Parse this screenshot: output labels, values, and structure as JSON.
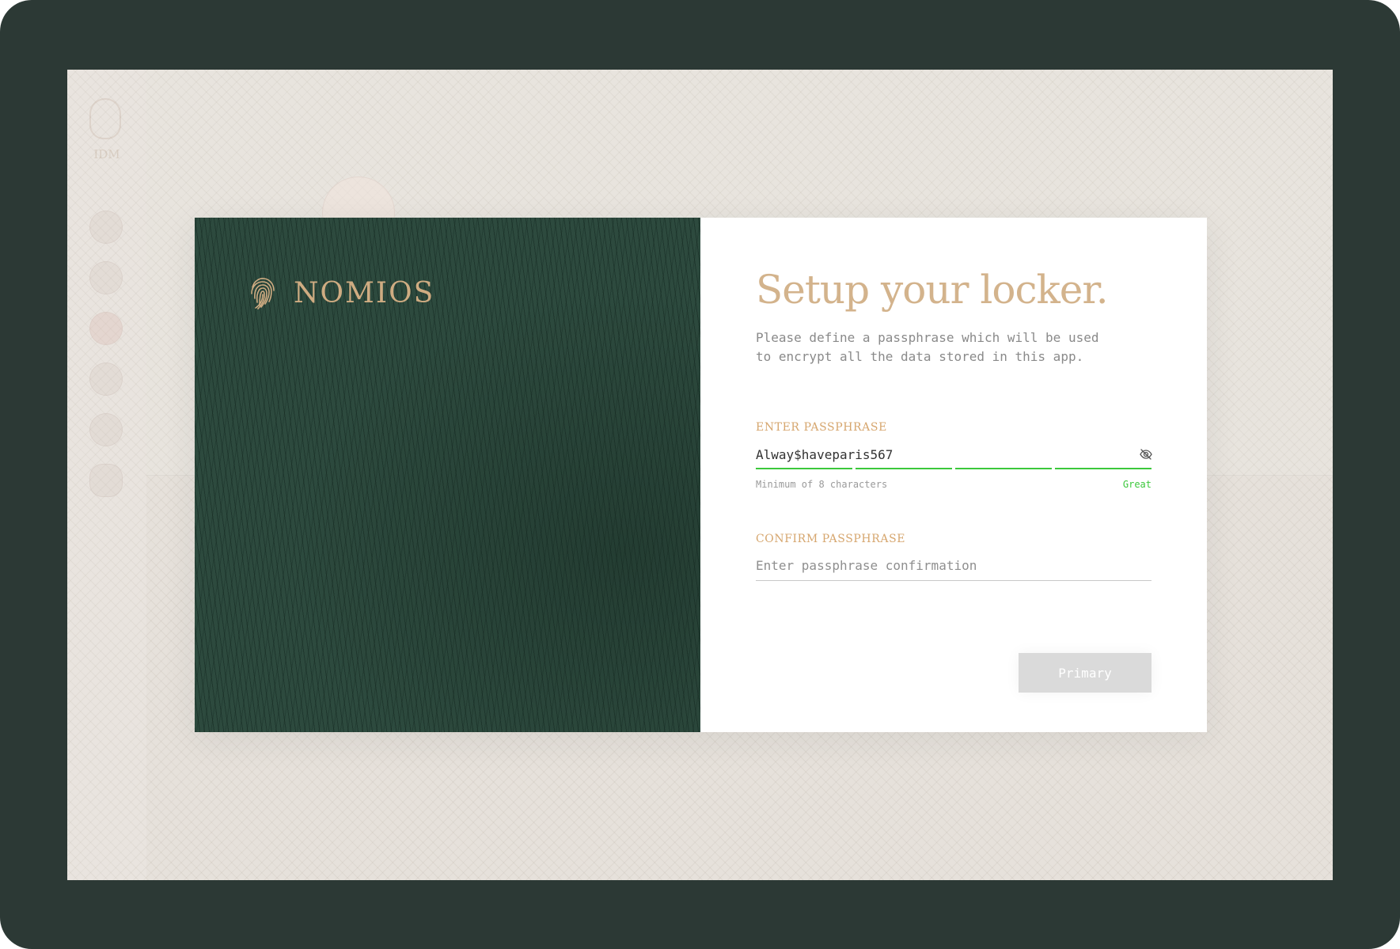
{
  "background_app": {
    "logo_text": "IDM"
  },
  "brand": {
    "name": "NOMIOS",
    "logo_icon": "fingerprint-icon"
  },
  "setup": {
    "title": "Setup your locker.",
    "description": "Please define a passphrase which will be used to encrypt all the data stored in this app."
  },
  "passphrase": {
    "label": "ENTER PASSPHRASE",
    "value": "Alway$haveparis567",
    "visibility_icon": "eye-off-icon",
    "hint": "Minimum of 8 characters",
    "strength_label": "Great",
    "strength_segments_filled": 4,
    "strength_segments_total": 4
  },
  "confirm": {
    "label": "CONFIRM PASSPHRASE",
    "placeholder": "Enter passphrase confirmation",
    "value": ""
  },
  "actions": {
    "primary_label": "Primary"
  },
  "colors": {
    "frame": "#2c3935",
    "panel_green": "#2d4a3e",
    "accent_gold": "#d3b38c",
    "strength_green": "#3cc83c",
    "button_disabled": "#dadada"
  }
}
